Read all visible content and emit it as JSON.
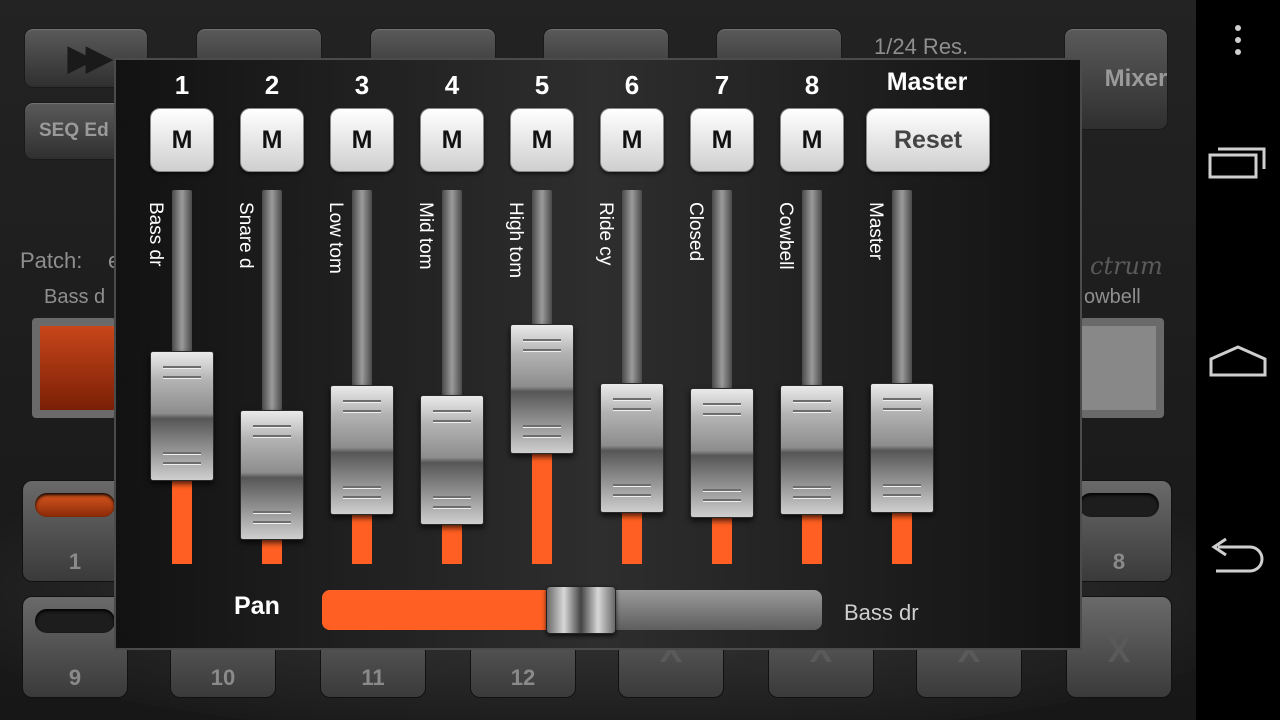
{
  "background": {
    "resolution_text": "1/24 Res.",
    "mixer_button": "Mixer",
    "seq_edit_button": "SEQ Ed",
    "patch_label": "Patch:",
    "patch_value": "e",
    "left_instrument": "Bass d",
    "right_instrument": "owbell",
    "brand_text": "ctrum",
    "pads": [
      {
        "label": "1",
        "led": "on"
      },
      {
        "label": "8",
        "led": "off"
      },
      {
        "label": "9",
        "led": "off"
      },
      {
        "label": "10",
        "led": "off"
      },
      {
        "label": "11",
        "led": "off"
      },
      {
        "label": "12",
        "led": "off"
      },
      {
        "label": "X",
        "led": "off"
      },
      {
        "label": "X",
        "led": "off"
      },
      {
        "label": "X",
        "led": "off"
      },
      {
        "label": "X",
        "led": "off"
      }
    ]
  },
  "mixer": {
    "master_label": "Master",
    "reset_label": "Reset",
    "mute_label": "M",
    "accent_color": "#ff5f22",
    "channels": [
      {
        "number": "1",
        "name": "Bass dr",
        "level": 0.34
      },
      {
        "number": "2",
        "name": "Snare d",
        "level": 0.1
      },
      {
        "number": "3",
        "name": "Low tom",
        "level": 0.2
      },
      {
        "number": "4",
        "name": "Mid tom",
        "level": 0.16
      },
      {
        "number": "5",
        "name": "High tom",
        "level": 0.45
      },
      {
        "number": "6",
        "name": "Ride cy",
        "level": 0.21
      },
      {
        "number": "7",
        "name": "Closed",
        "level": 0.19
      },
      {
        "number": "8",
        "name": "Cowbell",
        "level": 0.2
      }
    ],
    "master": {
      "name": "Master",
      "level": 0.21
    },
    "pan": {
      "label": "Pan",
      "value": 0.52,
      "channel_name": "Bass dr"
    }
  },
  "navbar": {
    "icons": [
      "overflow-menu-icon",
      "recent-apps-icon",
      "home-icon",
      "back-icon"
    ]
  }
}
